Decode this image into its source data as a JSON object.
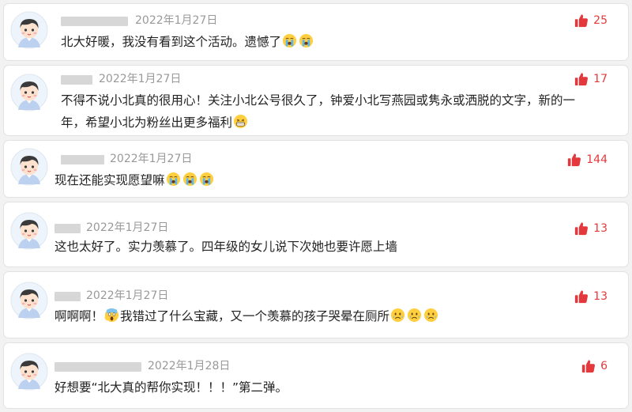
{
  "comments": [
    {
      "date": "2022年1月27日",
      "likes": "25",
      "text": "北大好暖，我没有看到这个活动。遗憾了",
      "emojis": [
        "crying-face",
        "crying-face"
      ]
    },
    {
      "date": "2022年1月27日",
      "likes": "17",
      "text_line1": "不得不说小北真的很用心！关注小北公号很久了，钟爱小北写燕园或隽永或洒脱的文字，新的一",
      "text_line2": "年，希望小北为粉丝出更多福利",
      "emojis": [
        "grinning-face"
      ]
    },
    {
      "date": "2022年1月27日",
      "likes": "144",
      "text": "现在还能实现愿望嘛",
      "emojis": [
        "crying-face",
        "crying-face",
        "crying-face"
      ]
    },
    {
      "date": "2022年1月27日",
      "likes": "13",
      "text": "这也太好了。实力羡慕了。四年级的女儿说下次她也要许愿上墙",
      "emojis": []
    },
    {
      "date": "2022年1月27日",
      "likes": "13",
      "text_pre": "啊啊啊！",
      "text_post": "我错过了什么宝藏，又一个羡慕的孩子哭晕在厕所",
      "emojis": [
        "screaming-face",
        "sad-face",
        "sad-face",
        "sad-face"
      ]
    },
    {
      "date": "2022年1月28日",
      "likes": "6",
      "text": "好想要“北大真的帮你实现！！！”第二弹。",
      "emojis": []
    }
  ],
  "colors": {
    "like": "#e4393c",
    "date": "#999999",
    "text": "#222222"
  }
}
